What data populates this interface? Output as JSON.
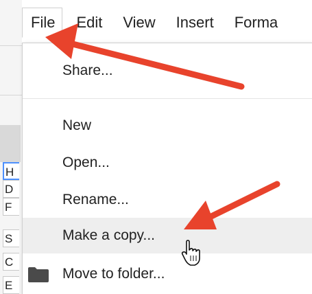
{
  "menubar": {
    "items": [
      {
        "label": "File",
        "open": true
      },
      {
        "label": "Edit"
      },
      {
        "label": "View"
      },
      {
        "label": "Insert"
      },
      {
        "label": "Forma"
      }
    ]
  },
  "file_menu": {
    "share_label": "Share...",
    "new_label": "New",
    "open_label": "Open...",
    "rename_label": "Rename...",
    "make_copy_label": "Make a copy...",
    "move_to_folder_label": "Move to folder...",
    "hovered_item": "Make a copy..."
  },
  "background_cells": [
    "H",
    "D",
    "F",
    "S",
    "C",
    "E"
  ],
  "colors": {
    "annotation_arrow": "#e8432c",
    "hover_background": "#eeeeee",
    "selection_border": "#4d90fe"
  },
  "icons": {
    "folder": "folder-icon",
    "cursor": "hand-pointer-icon"
  }
}
